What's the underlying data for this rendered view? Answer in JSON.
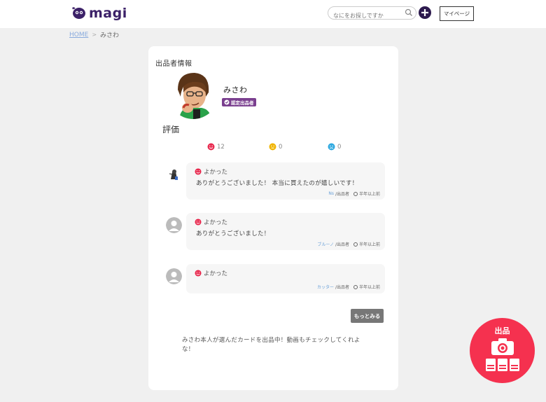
{
  "header": {
    "logo_text": "magi",
    "search_placeholder": "なにをお探しですか",
    "mypage_label": "マイページ"
  },
  "breadcrumb": {
    "home": "HOME",
    "sep": ">",
    "current": "みさわ"
  },
  "seller": {
    "section_title": "出品者情報",
    "name": "みさわ",
    "badge": "認定出品者"
  },
  "ratings": {
    "title": "評価",
    "good": "12",
    "neutral": "0",
    "bad": "0"
  },
  "reviews": [
    {
      "rating": "よかった",
      "text": "ありがとうございました！ 本当に買えたのが嬉しいです！",
      "user": "Ns",
      "role": "/出品者",
      "time": "半年以上前"
    },
    {
      "rating": "よかった",
      "text": "ありがとうございました！",
      "user": "ブルーノ",
      "role": "/出品者",
      "time": "半年以上前"
    },
    {
      "rating": "よかった",
      "text": "",
      "user": "カッター",
      "role": "/出品者",
      "time": "半年以上前"
    }
  ],
  "more_label": "もっとみる",
  "profile_text": "みさわ本人が選んだカードを出品中！動画もチェックしてくれよな！",
  "fab": {
    "label": "出品"
  },
  "colors": {
    "brand": "#3c2168",
    "good": "#e8294e",
    "neutral": "#f0b400",
    "bad": "#2fa9e0",
    "fab": "#f5314f",
    "badge": "#7a3f8f"
  }
}
